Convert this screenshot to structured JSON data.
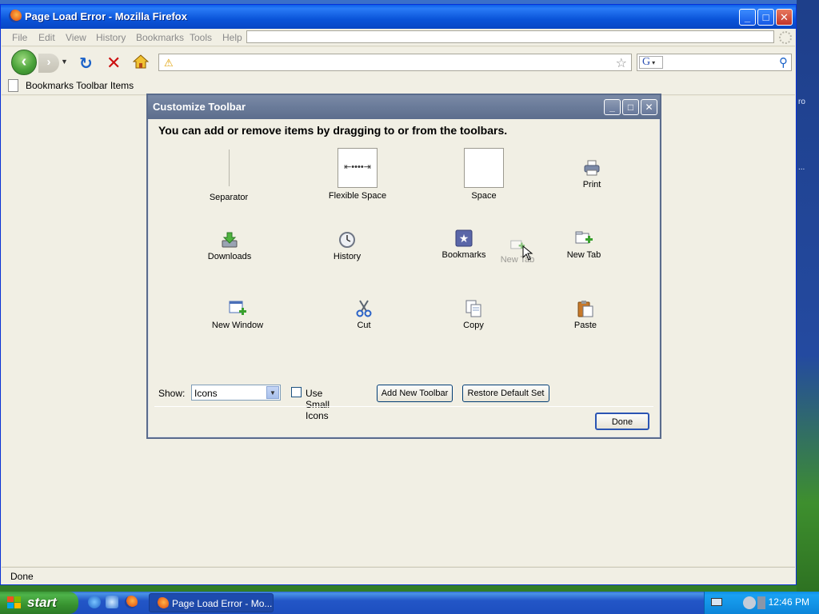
{
  "window": {
    "title": "Page Load Error - Mozilla Firefox",
    "controls": {
      "minimize": "_",
      "maximize": "□",
      "close": "✕"
    }
  },
  "menubar": {
    "items": [
      "File",
      "Edit",
      "View",
      "History",
      "Bookmarks",
      "Tools",
      "Help"
    ]
  },
  "navbar": {
    "url_value": "",
    "search_engine": "G",
    "search_value": ""
  },
  "bookmarks_bar": {
    "label": "Bookmarks Toolbar Items"
  },
  "status": {
    "text": "Done"
  },
  "dialog": {
    "title": "Customize Toolbar",
    "heading": "You can add or remove items by dragging to or from the toolbars.",
    "items": [
      {
        "label": "Separator",
        "icon": "separator"
      },
      {
        "label": "Flexible Space",
        "icon": "flexible-space"
      },
      {
        "label": "Space",
        "icon": "space"
      },
      {
        "label": "Print",
        "icon": "print-icon"
      },
      {
        "label": "Downloads",
        "icon": "downloads-icon"
      },
      {
        "label": "History",
        "icon": "history-icon"
      },
      {
        "label": "Bookmarks",
        "icon": "bookmarks-icon"
      },
      {
        "label": "New Tab",
        "icon": "new-tab-icon"
      },
      {
        "label": "New Window",
        "icon": "new-window-icon"
      },
      {
        "label": "Cut",
        "icon": "cut-icon"
      },
      {
        "label": "Copy",
        "icon": "copy-icon"
      },
      {
        "label": "Paste",
        "icon": "paste-icon"
      }
    ],
    "dragging_item": {
      "label": "New Tab"
    },
    "show_label": "Show:",
    "show_value": "Icons",
    "small_icons_label": "Use Small Icons",
    "small_icons_checked": false,
    "add_toolbar_label": "Add New Toolbar",
    "restore_label": "Restore Default Set",
    "done_label": "Done"
  },
  "taskbar": {
    "start_label": "start",
    "task_label": "Page Load Error - Mo...",
    "clock": "12:46 PM"
  },
  "colors": {
    "xp_blue": "#0a54d9",
    "dialog_title": "#6a7b99",
    "start_green": "#37922f"
  }
}
